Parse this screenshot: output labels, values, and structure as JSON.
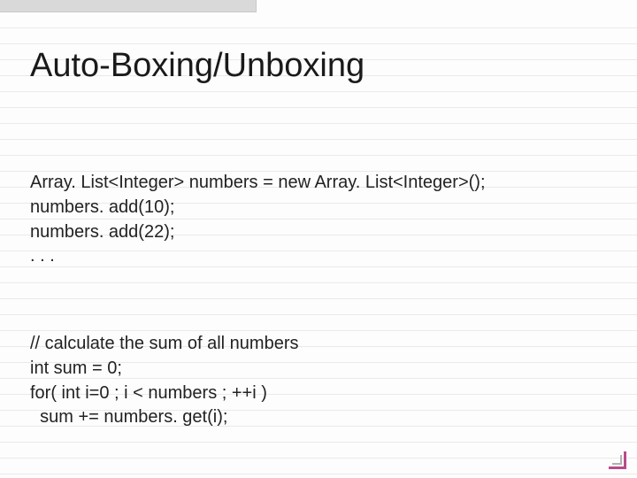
{
  "slide": {
    "title": "Auto-Boxing/Unboxing",
    "block1": {
      "line1": "Array. List<Integer> numbers = new Array. List<Integer>();",
      "line2": "numbers. add(10);",
      "line3": "numbers. add(22);",
      "line4": ". . ."
    },
    "block2": {
      "line1": "// calculate the sum of all numbers",
      "line2": "int sum = 0;",
      "line3": "for( int i=0 ; i < numbers ; ++i )",
      "line4": "  sum += numbers. get(i);"
    }
  }
}
